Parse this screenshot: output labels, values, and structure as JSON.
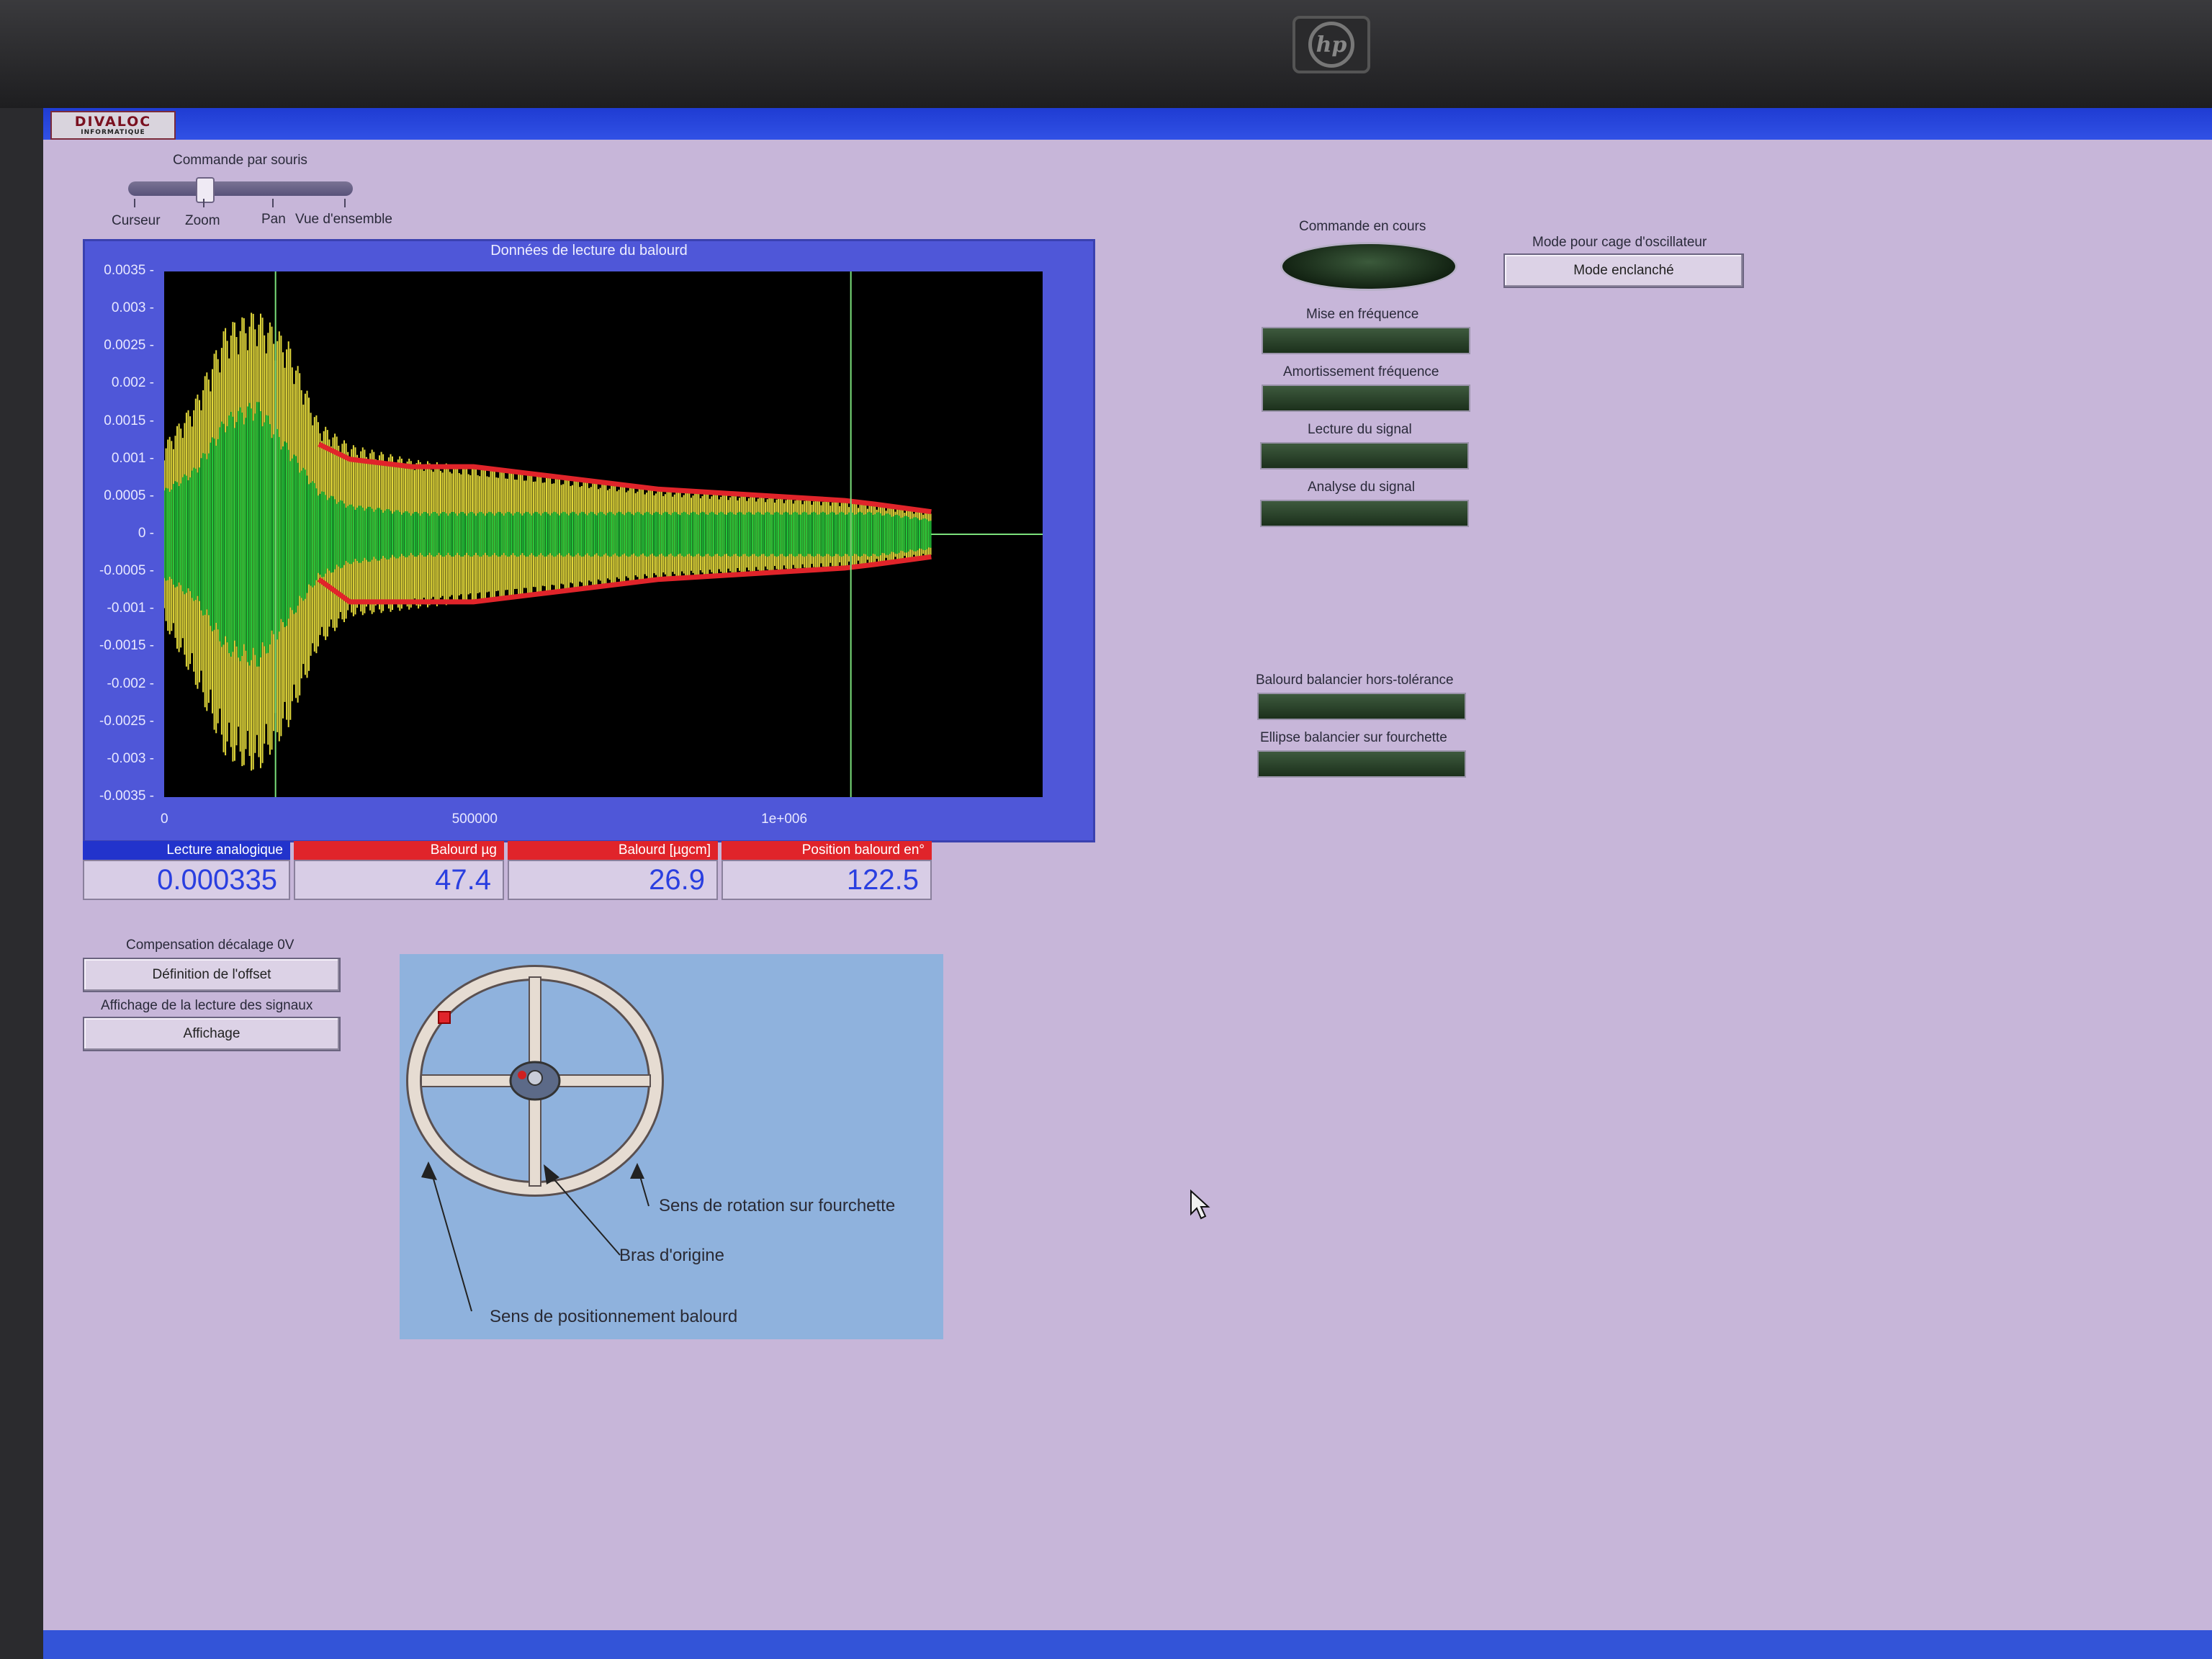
{
  "app": {
    "logo_line1": "DIVALOC",
    "logo_line2": "INFORMATIQUE"
  },
  "mouse_command": {
    "label": "Commande par souris",
    "options": [
      "Curseur",
      "Zoom",
      "Pan",
      "Vue d'ensemble"
    ],
    "selected": "Zoom"
  },
  "graph": {
    "title": "Données de lecture du balourd",
    "y_ticks": [
      "0.0035",
      "0.003",
      "0.0025",
      "0.002",
      "0.0015",
      "0.001",
      "0.0005",
      "0",
      "-0.0005",
      "-0.001",
      "-0.0015",
      "-0.002",
      "-0.0025",
      "-0.003",
      "-0.0035"
    ],
    "x_ticks": [
      "0",
      "500000",
      "1e+006"
    ]
  },
  "chart_data": {
    "type": "line",
    "title": "Données de lecture du balourd",
    "xlabel": "",
    "ylabel": "",
    "xlim": [
      0,
      1420000
    ],
    "ylim": [
      -0.0035,
      0.0035
    ],
    "grid": false,
    "series": [
      {
        "color": "#e2d83a",
        "x": [
          0,
          50000,
          100000,
          150000,
          200000,
          250000,
          300000,
          400000,
          500000,
          600000,
          700000,
          800000,
          900000,
          1000000,
          1100000,
          1150000,
          1240000
        ],
        "y_upper": [
          0.0012,
          0.0018,
          0.0028,
          0.003,
          0.0026,
          0.0015,
          0.0012,
          0.001,
          0.0009,
          0.0008,
          0.0007,
          0.0006,
          0.00055,
          0.0005,
          0.00045,
          0.0004,
          0.0003
        ],
        "y_lower": [
          -0.0012,
          -0.002,
          -0.003,
          -0.0032,
          -0.0026,
          -0.0015,
          -0.0011,
          -0.001,
          -0.0009,
          -0.0008,
          -0.0007,
          -0.0006,
          -0.00055,
          -0.0005,
          -0.00045,
          -0.0004,
          -0.0003
        ]
      },
      {
        "color": "#23c63a",
        "x": [
          0,
          50000,
          100000,
          150000,
          200000,
          250000,
          300000,
          400000,
          500000,
          600000,
          700000,
          800000,
          900000,
          1000000,
          1100000,
          1150000,
          1240000
        ],
        "y_upper": [
          0.0006,
          0.0009,
          0.0016,
          0.0018,
          0.0012,
          0.0006,
          0.0004,
          0.0003,
          0.0003,
          0.0003,
          0.0003,
          0.0003,
          0.0003,
          0.0003,
          0.0003,
          0.0003,
          0.0002
        ],
        "y_lower": [
          -0.0006,
          -0.0009,
          -0.0016,
          -0.0018,
          -0.0012,
          -0.0006,
          -0.0004,
          -0.0003,
          -0.0003,
          -0.0003,
          -0.0003,
          -0.0003,
          -0.0003,
          -0.0003,
          -0.0003,
          -0.0003,
          -0.0002
        ]
      },
      {
        "color": "#e0242a",
        "x": [
          250000,
          300000,
          400000,
          500000,
          600000,
          700000,
          800000,
          900000,
          1000000,
          1100000,
          1150000,
          1240000
        ],
        "y_upper": [
          0.0012,
          0.001,
          0.0009,
          0.0009,
          0.0008,
          0.0007,
          0.0006,
          0.00055,
          0.0005,
          0.00045,
          0.0004,
          0.0003
        ],
        "y_lower": [
          -0.0006,
          -0.0009,
          -0.0009,
          -0.0009,
          -0.0008,
          -0.0007,
          -0.0006,
          -0.00055,
          -0.0005,
          -0.00045,
          -0.0004,
          -0.0003
        ]
      }
    ],
    "cursors_x": [
      180000,
      1110000
    ]
  },
  "readouts": [
    {
      "label": "Lecture analogique",
      "value": "0.000335",
      "color": "#2233cc"
    },
    {
      "label": "Balourd µg",
      "value": "47.4",
      "color": "#e0242a"
    },
    {
      "label": "Balourd [µgcm]",
      "value": "26.9",
      "color": "#e0242a"
    },
    {
      "label": "Position balourd en°",
      "value": "122.5",
      "color": "#e0242a"
    }
  ],
  "offset": {
    "label": "Compensation décalage 0V",
    "button": "Définition de l'offset"
  },
  "display": {
    "label": "Affichage de la lecture des signaux",
    "button": "Affichage"
  },
  "diagram": {
    "label_rotation": "Sens de rotation sur fourchette",
    "label_arm": "Bras d'origine",
    "label_position": "Sens de positionnement balourd"
  },
  "status": {
    "current": "Commande en cours",
    "frequency": "Mise en fréquence",
    "damping": "Amortissement fréquence",
    "reading": "Lecture du signal",
    "analysis": "Analyse du signal",
    "tolerance": "Balourd balancier hors-tolérance",
    "ellipse": "Ellipse balancier sur fourchette"
  },
  "mode": {
    "label": "Mode pour cage d'oscillateur",
    "button": "Mode enclanché"
  },
  "colors": {
    "screen_bg": "#c7b6d9",
    "graph_frame": "#4f57d8",
    "readout_value": "#2a3fe0",
    "led_off": "#2a432a"
  }
}
